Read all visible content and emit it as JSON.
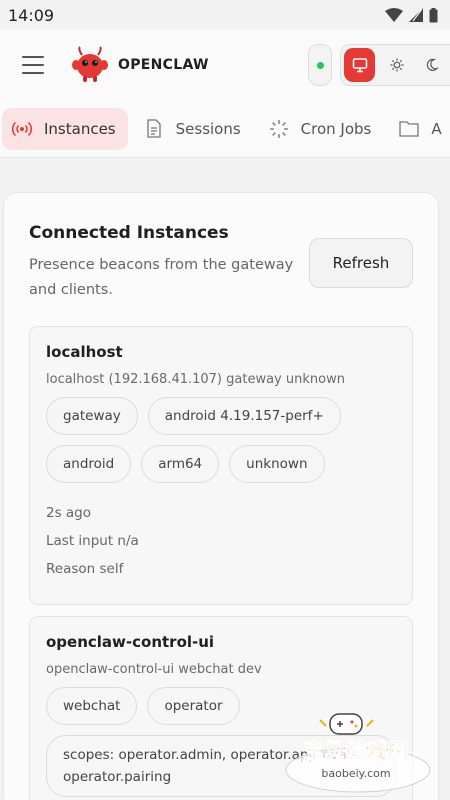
{
  "status_bar": {
    "time": "14:09"
  },
  "header": {
    "brand": "OPENCLAW",
    "connection": "connected"
  },
  "tabs": [
    {
      "label": "Instances",
      "icon": "radio-icon",
      "active": true
    },
    {
      "label": "Sessions",
      "icon": "document-icon",
      "active": false
    },
    {
      "label": "Cron Jobs",
      "icon": "loader-icon",
      "active": false
    },
    {
      "label": "A",
      "icon": "folder-icon",
      "active": false
    }
  ],
  "card": {
    "title": "Connected Instances",
    "subtitle": "Presence beacons from the gateway and clients.",
    "refresh_label": "Refresh"
  },
  "instances": [
    {
      "name": "localhost",
      "detail": "localhost (192.168.41.107) gateway unknown",
      "chips": [
        "gateway",
        "android 4.19.157-perf+",
        "android",
        "arm64",
        "unknown"
      ],
      "meta": [
        "2s ago",
        "Last input n/a",
        "Reason self"
      ]
    },
    {
      "name": "openclaw-control-ui",
      "detail": "openclaw-control-ui webchat dev",
      "chips": [
        "webchat",
        "operator"
      ],
      "scopes": "scopes: operator.admin, operator.approvals, operator.pairing"
    }
  ],
  "watermark": {
    "title": "宝贝游戏网",
    "url": "baobeiy.com"
  },
  "colors": {
    "accent": "#e53935",
    "tab_active_bg": "#fbe3e3",
    "online": "#22c55e"
  }
}
